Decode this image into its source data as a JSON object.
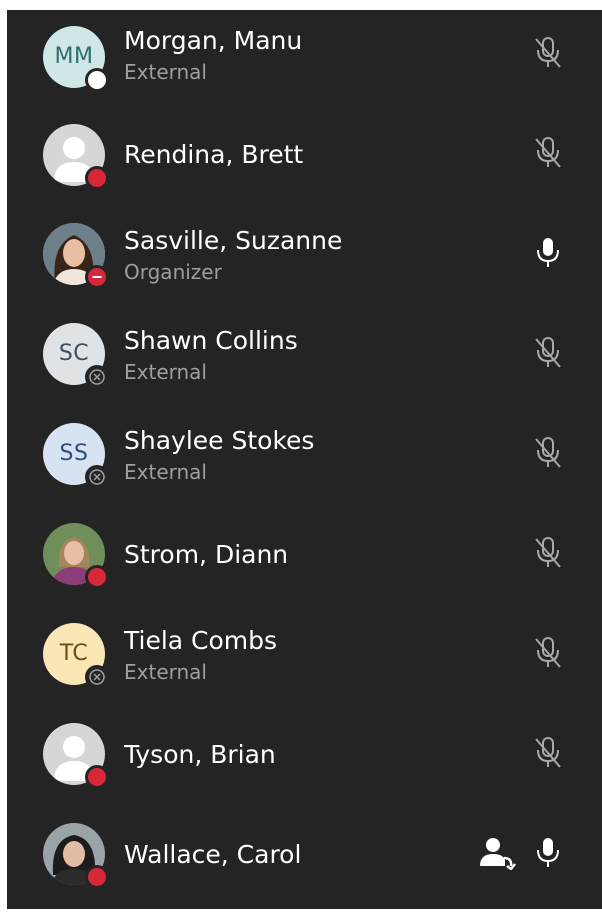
{
  "colors": {
    "panel_bg": "#242424",
    "name_text": "#ffffff",
    "role_text": "#9e9e9e",
    "busy_red": "#d62839",
    "mic_muted": "#a8a8a8",
    "mic_active": "#ffffff"
  },
  "participants": [
    {
      "name": "Morgan, Manu",
      "role": "External",
      "avatar": "initials",
      "initials": "MM",
      "avatar_bg": "#cfe7e6",
      "initials_color": "#2f6d73",
      "presence": "offline-white",
      "mic": "mic-off-icon"
    },
    {
      "name": "Rendina, Brett",
      "role": "",
      "avatar": "placeholder-person",
      "presence": "busy",
      "mic": "mic-off-icon"
    },
    {
      "name": "Sasville, Suzanne",
      "role": "Organizer",
      "avatar": "photo",
      "presence": "do-not-disturb",
      "mic": "mic-on-icon"
    },
    {
      "name": "Shawn Collins",
      "role": "External",
      "avatar": "initials",
      "initials": "SC",
      "avatar_bg": "#dfe3e6",
      "initials_color": "#3b4f63",
      "presence": "unknown",
      "mic": "mic-off-icon"
    },
    {
      "name": "Shaylee Stokes",
      "role": "External",
      "avatar": "initials",
      "initials": "SS",
      "avatar_bg": "#d7e3f2",
      "initials_color": "#2f4d80",
      "presence": "unknown",
      "mic": "mic-off-icon"
    },
    {
      "name": "Strom, Diann",
      "role": "",
      "avatar": "photo",
      "presence": "busy",
      "mic": "mic-off-icon"
    },
    {
      "name": "Tiela Combs",
      "role": "External",
      "avatar": "initials",
      "initials": "TC",
      "avatar_bg": "#fbe7b5",
      "initials_color": "#6b4e14",
      "presence": "unknown",
      "mic": "mic-off-icon"
    },
    {
      "name": "Tyson, Brian",
      "role": "",
      "avatar": "placeholder-person",
      "presence": "busy",
      "mic": "mic-off-icon"
    },
    {
      "name": "Wallace, Carol",
      "role": "",
      "avatar": "photo",
      "presence": "busy",
      "mic": "mic-on-icon",
      "extra_icon": "share-screen-person-icon"
    }
  ]
}
